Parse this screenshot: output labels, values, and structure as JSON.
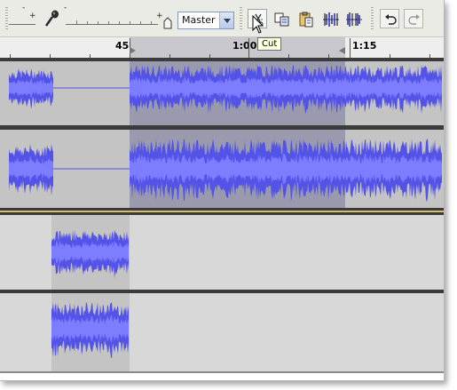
{
  "toolbar": {
    "mic_icon": "microphone-icon",
    "slider_minus": "-",
    "slider_plus": "+",
    "mixer_select_value": "Master",
    "buttons": [
      {
        "name": "cut-button",
        "icon": "scissors-icon",
        "tooltip": "Cut"
      },
      {
        "name": "copy-button",
        "icon": "copy-icon"
      },
      {
        "name": "paste-button",
        "icon": "paste-icon"
      },
      {
        "name": "trim-button",
        "icon": "trim-icon"
      },
      {
        "name": "silence-button",
        "icon": "silence-icon"
      },
      {
        "name": "undo-button",
        "icon": "undo-icon"
      },
      {
        "name": "redo-button",
        "icon": "redo-icon"
      }
    ]
  },
  "tooltip": {
    "text": "Cut"
  },
  "ruler": {
    "labels": [
      "45",
      "1:00",
      "1:15"
    ]
  },
  "colors": {
    "wave_main": "#5353e8",
    "wave_light": "#7d7dff",
    "track_bg": "#c4c4c4",
    "selection": "#9a9aae",
    "empty_track": "#d8d8d8"
  },
  "tracks": [
    {
      "name": "track-1",
      "clips": 2
    },
    {
      "name": "track-2",
      "clips": 2
    },
    {
      "name": "track-3",
      "clips": 1
    },
    {
      "name": "track-4",
      "clips": 1
    }
  ]
}
